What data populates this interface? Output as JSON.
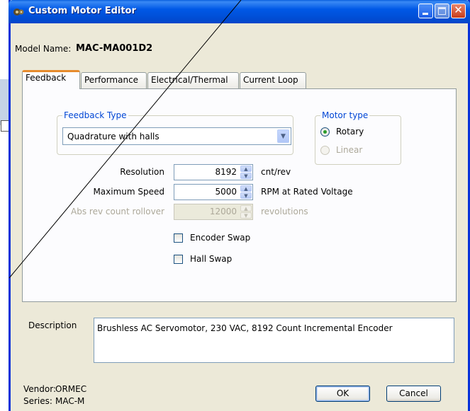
{
  "window": {
    "title": "Custom Motor Editor"
  },
  "model": {
    "label": "Model Name:",
    "value": "MAC-MA001D2"
  },
  "tabs": [
    {
      "label": "Feedback",
      "active": true
    },
    {
      "label": "Performance",
      "active": false
    },
    {
      "label": "Electrical/Thermal",
      "active": false
    },
    {
      "label": "Current Loop",
      "active": false
    }
  ],
  "feedback": {
    "group_title": "Feedback Type",
    "selected": "Quadrature with halls"
  },
  "motor_type": {
    "group_title": "Motor type",
    "options": [
      {
        "label": "Rotary",
        "checked": true,
        "enabled": true
      },
      {
        "label": "Linear",
        "checked": false,
        "enabled": false
      }
    ]
  },
  "fields": [
    {
      "label": "Resolution",
      "value": "8192",
      "unit": "cnt/rev",
      "enabled": true
    },
    {
      "label": "Maximum Speed",
      "value": "5000",
      "unit": "RPM at Rated Voltage",
      "enabled": true
    },
    {
      "label": "Abs rev count rollover",
      "value": "12000",
      "unit": "revolutions",
      "enabled": false
    }
  ],
  "checkboxes": [
    {
      "label": "Encoder Swap",
      "checked": false
    },
    {
      "label": "Hall Swap",
      "checked": false
    }
  ],
  "description": {
    "label": "Description",
    "value": "Brushless AC Servomotor, 230 VAC, 8192 Count Incremental Encoder"
  },
  "vendor": {
    "label": "Vendor:",
    "value": "ORMEC"
  },
  "series": {
    "label": "Series:",
    "value": "MAC-M"
  },
  "buttons": {
    "ok": "OK",
    "cancel": "Cancel"
  },
  "colors": {
    "titlebar": "#0058e6",
    "group_title": "#0046d5",
    "active_tab_accent": "#e68b2c",
    "dialog_bg": "#ece9d8"
  },
  "icons": {
    "title": "app-gear-icon",
    "minimize": "minimize-icon",
    "maximize": "maximize-icon",
    "close": "close-icon",
    "dropdown": "chevron-down-icon"
  }
}
